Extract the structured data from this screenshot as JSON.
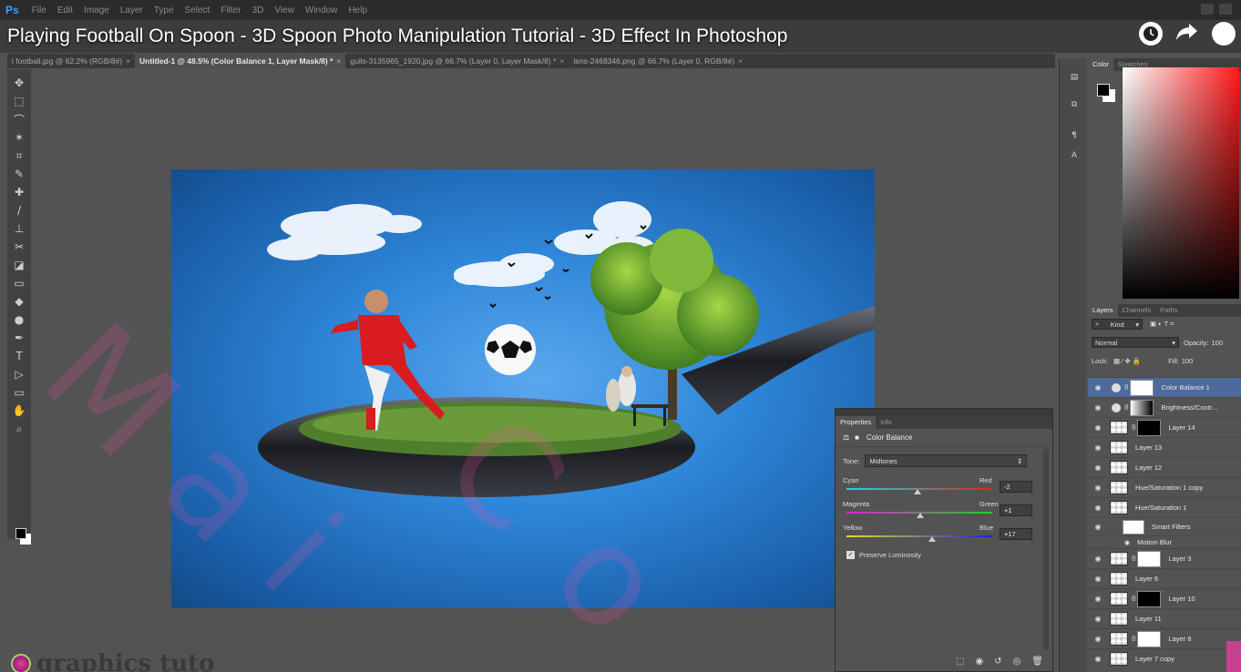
{
  "menubar": {
    "logo": "Ps",
    "items": [
      "File",
      "Edit",
      "Image",
      "Layer",
      "Type",
      "Select",
      "Filter",
      "3D",
      "View",
      "Window",
      "Help"
    ]
  },
  "video": {
    "title": "Playing Football On Spoon - 3D Spoon Photo Manipulation Tutorial - 3D Effect In Photoshop"
  },
  "tabs": [
    {
      "label": "i football.jpg @ 62.2% (RGB/8#)",
      "active": false
    },
    {
      "label": "Untitled-1 @ 48.5% (Color Balance 1, Layer Mask/8) *",
      "active": true
    },
    {
      "label": "gulls-3135965_1920.jpg @ 66.7% (Layer 0, Layer Mask/8) *",
      "active": false
    },
    {
      "label": "lens-2468346.png @ 66.7% (Layer 0, RGB/8#)",
      "active": false
    }
  ],
  "tools": [
    "move-tool",
    "marquee-tool",
    "lasso-tool",
    "magic-wand-tool",
    "crop-tool",
    "eyedropper-tool",
    "healing-tool",
    "brush-tool",
    "stamp-tool",
    "history-brush-tool",
    "eraser-tool",
    "gradient-tool",
    "blur-tool",
    "dodge-tool",
    "pen-tool",
    "type-tool",
    "path-select-tool",
    "shape-tool",
    "hand-tool",
    "zoom-tool"
  ],
  "color_panel": {
    "tabs": [
      "Color",
      "Swatches"
    ],
    "foreground": "#000000",
    "background": "#ffffff"
  },
  "layers_panel": {
    "tabs": [
      "Layers",
      "Channels",
      "Paths"
    ],
    "filter_label": "Kind",
    "blend_mode": "Normal",
    "opacity_label": "Opacity:",
    "opacity_value": "100",
    "lock_label": "Lock:",
    "fill_label": "Fill:",
    "fill_value": "100",
    "layers": [
      {
        "name": "Color Balance 1",
        "type": "adjustment",
        "selected": true
      },
      {
        "name": "Brightness/Contr...",
        "type": "adjustment",
        "selected": false
      },
      {
        "name": "Layer 14",
        "type": "masked",
        "selected": false
      },
      {
        "name": "Layer 13",
        "type": "pixel",
        "selected": false
      },
      {
        "name": "Layer 12",
        "type": "pixel",
        "selected": false
      },
      {
        "name": "Hue/Saturation 1 copy",
        "type": "pixel",
        "selected": false
      },
      {
        "name": "Hue/Saturation 1",
        "type": "smart",
        "selected": false
      },
      {
        "name": "Smart Filters",
        "type": "sub",
        "selected": false
      },
      {
        "name": "Motion Blur",
        "type": "sub2",
        "selected": false
      },
      {
        "name": "Layer 3",
        "type": "masked",
        "selected": false
      },
      {
        "name": "Layer 6",
        "type": "pixel",
        "selected": false
      },
      {
        "name": "Layer 10",
        "type": "masked",
        "selected": false
      },
      {
        "name": "Layer 11",
        "type": "pixel",
        "selected": false
      },
      {
        "name": "Layer 8",
        "type": "masked",
        "selected": false
      },
      {
        "name": "Layer 7 copy",
        "type": "pixel",
        "selected": false
      }
    ]
  },
  "properties": {
    "tabs": [
      "Properties",
      "Info"
    ],
    "title": "Color Balance",
    "tone_label": "Tone:",
    "tone_value": "Midtones",
    "sliders": [
      {
        "left": "Cyan",
        "right": "Red",
        "value": "-2",
        "level": -2
      },
      {
        "left": "Magenta",
        "right": "Green",
        "value": "+1",
        "level": 1
      },
      {
        "left": "Yellow",
        "right": "Blue",
        "value": "+17",
        "level": 17
      }
    ],
    "preserve_label": "Preserve Luminosity",
    "preserve_checked": true
  },
  "brand": {
    "text": "graphics tuto"
  }
}
